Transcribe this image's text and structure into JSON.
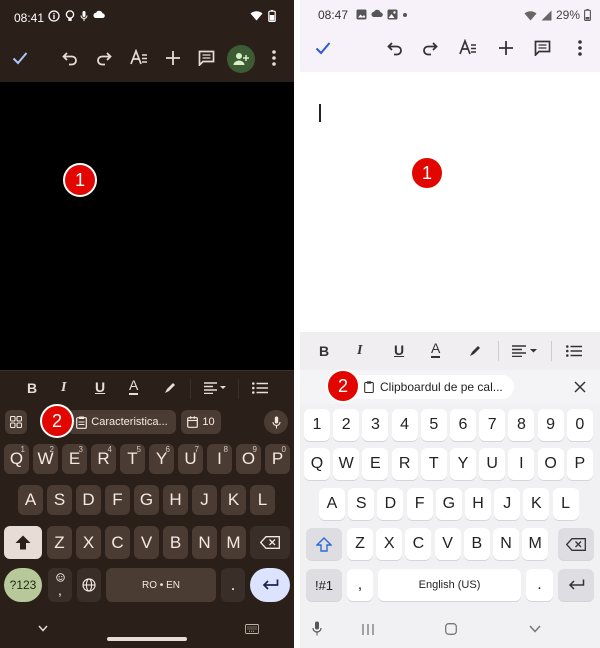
{
  "left": {
    "status": {
      "time": "08:41"
    },
    "badge1": "1",
    "badge2": "2",
    "suggestions": {
      "chip1": "Caracteristica...",
      "chip2": "10"
    },
    "keyboard": {
      "row1": [
        {
          "k": "Q",
          "h": "1"
        },
        {
          "k": "W",
          "h": "2"
        },
        {
          "k": "E",
          "h": "3"
        },
        {
          "k": "R",
          "h": "4"
        },
        {
          "k": "T",
          "h": "5"
        },
        {
          "k": "Y",
          "h": "6"
        },
        {
          "k": "U",
          "h": "7"
        },
        {
          "k": "I",
          "h": "8"
        },
        {
          "k": "O",
          "h": "9"
        },
        {
          "k": "P",
          "h": "0"
        }
      ],
      "row2": [
        "A",
        "S",
        "D",
        "F",
        "G",
        "H",
        "J",
        "K",
        "L"
      ],
      "row3": [
        "Z",
        "X",
        "C",
        "V",
        "B",
        "N",
        "M"
      ],
      "sym_label": "?123",
      "emoji_comma": ",",
      "space_label": "RO • EN",
      "period": "."
    },
    "format": {
      "bold": "B",
      "italic": "I",
      "underline": "U",
      "textcolor": "A"
    }
  },
  "right": {
    "status": {
      "time": "08:47",
      "battery": "29%"
    },
    "badge1": "1",
    "badge2": "2",
    "clipboard_label": "Clipboardul de pe cal...",
    "format": {
      "bold": "B",
      "italic": "I",
      "underline": "U",
      "textcolor": "A"
    },
    "keyboard": {
      "numrow": [
        "1",
        "2",
        "3",
        "4",
        "5",
        "6",
        "7",
        "8",
        "9",
        "0"
      ],
      "row1": [
        "Q",
        "W",
        "E",
        "R",
        "T",
        "Y",
        "U",
        "I",
        "O",
        "P"
      ],
      "row2": [
        "A",
        "S",
        "D",
        "F",
        "G",
        "H",
        "J",
        "K",
        "L"
      ],
      "row3": [
        "Z",
        "X",
        "C",
        "V",
        "B",
        "N",
        "M"
      ],
      "sym_label": "!#1",
      "comma": ",",
      "space_label": "English (US)",
      "period": "."
    }
  }
}
